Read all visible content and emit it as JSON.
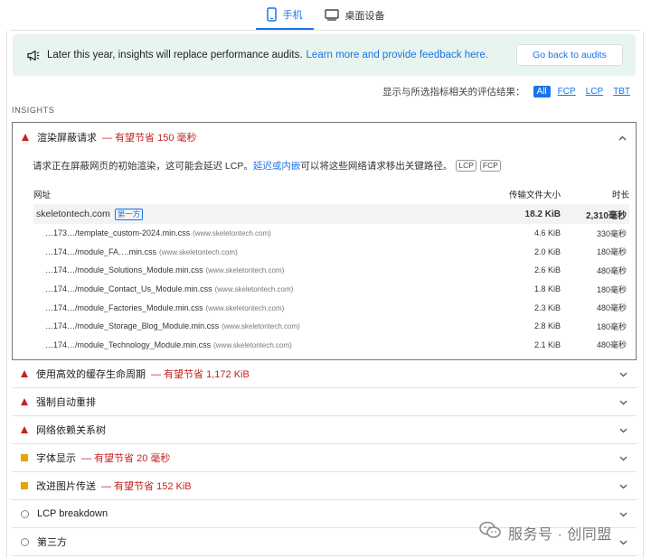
{
  "tabs": [
    {
      "label": "手机",
      "icon": "phone-icon",
      "active": true
    },
    {
      "label": "桌面设备",
      "icon": "desktop-icon",
      "active": false
    }
  ],
  "notice": {
    "text": "Later this year, insights will replace performance audits.",
    "link": "Learn more and provide feedback here.",
    "button": "Go back to audits",
    "background": "#e8f5ee"
  },
  "filter": {
    "label": "显示与所选指标相关的评估结果：",
    "options": [
      "All",
      "FCP",
      "LCP",
      "TBT"
    ],
    "selected": "All"
  },
  "section_label": "INSIGHTS",
  "expanded_audit": {
    "title": "渲染屏蔽请求",
    "savings": "— 有望节省 150 毫秒",
    "description_before": "请求正在屏蔽网页的初始渲染，这可能会延迟 LCP。",
    "description_link": "延迟或内嵌",
    "description_after": "可以将这些网络请求移出关键路径。",
    "badges": [
      "LCP",
      "FCP"
    ],
    "columns": {
      "url": "网址",
      "size": "传输文件大小",
      "duration": "时长"
    },
    "group": {
      "name": "skeletontech.com",
      "tag": "第一方",
      "size": "18.2 KiB",
      "duration": "2,310毫秒"
    },
    "rows": [
      {
        "url": "…173…/template_custom-2024.min.css",
        "host": "(www.skeletontech.com)",
        "size": "4.6 KiB",
        "duration": "330毫秒"
      },
      {
        "url": "…174…/module_FA….min.css",
        "host": "(www.skeletontech.com)",
        "size": "2.0 KiB",
        "duration": "180毫秒"
      },
      {
        "url": "…174…/module_Solutions_Module.min.css",
        "host": "(www.skeletontech.com)",
        "size": "2.6 KiB",
        "duration": "480毫秒"
      },
      {
        "url": "…174…/module_Contact_Us_Module.min.css",
        "host": "(www.skeletontech.com)",
        "size": "1.8 KiB",
        "duration": "180毫秒"
      },
      {
        "url": "…174…/module_Factories_Module.min.css",
        "host": "(www.skeletontech.com)",
        "size": "2.3 KiB",
        "duration": "480毫秒"
      },
      {
        "url": "…174…/module_Storage_Blog_Module.min.css",
        "host": "(www.skeletontech.com)",
        "size": "2.8 KiB",
        "duration": "180毫秒"
      },
      {
        "url": "…174…/module_Technology_Module.min.css",
        "host": "(www.skeletontech.com)",
        "size": "2.1 KiB",
        "duration": "480毫秒"
      }
    ]
  },
  "audits": [
    {
      "title": "使用高效的缓存生命周期",
      "savings": "— 有望节省 1,172 KiB",
      "severity": "fail"
    },
    {
      "title": "强制自动重排",
      "savings": "",
      "severity": "fail"
    },
    {
      "title": "网络依赖关系树",
      "savings": "",
      "severity": "fail"
    },
    {
      "title": "字体显示",
      "savings": "— 有望节省 20 毫秒",
      "severity": "average"
    },
    {
      "title": "改进图片传送",
      "savings": "— 有望节省 152 KiB",
      "severity": "average"
    },
    {
      "title": "LCP breakdown",
      "savings": "",
      "severity": "info"
    },
    {
      "title": "第三方",
      "savings": "",
      "severity": "info"
    }
  ],
  "colors": {
    "accent": "#1a73e8",
    "fail": "#c5221f",
    "average": "#e8a20b"
  },
  "watermark": "服务号 · 创同盟"
}
